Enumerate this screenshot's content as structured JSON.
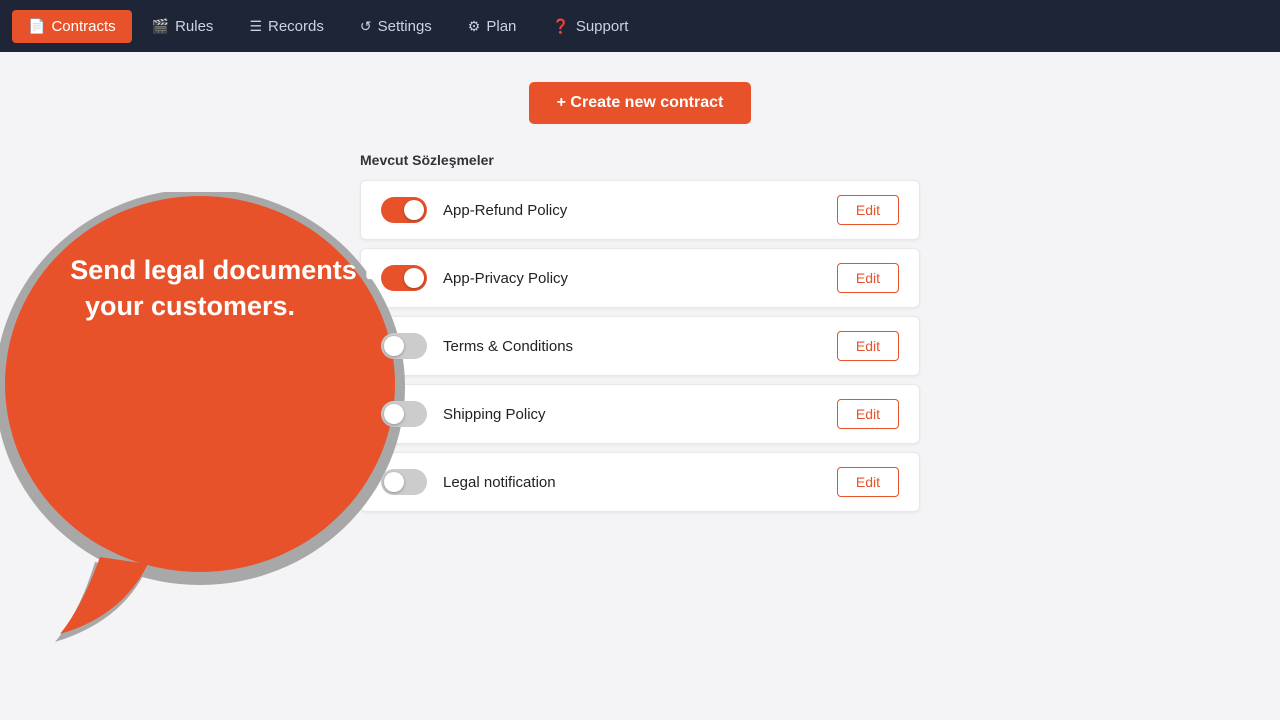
{
  "nav": {
    "items": [
      {
        "id": "contracts",
        "label": "Contracts",
        "icon": "📄",
        "active": true
      },
      {
        "id": "rules",
        "label": "Rules",
        "icon": "🎬",
        "active": false
      },
      {
        "id": "records",
        "label": "Records",
        "icon": "☰",
        "active": false
      },
      {
        "id": "settings",
        "label": "Settings",
        "icon": "↺",
        "active": false
      },
      {
        "id": "plan",
        "label": "Plan",
        "icon": "⚙",
        "active": false
      },
      {
        "id": "support",
        "label": "Support",
        "icon": "❓",
        "active": false
      }
    ]
  },
  "create_button": {
    "label": "+ Create new contract"
  },
  "section": {
    "title": "Mevcut Sözleşmeler",
    "contracts": [
      {
        "id": "refund",
        "name": "App-Refund Policy",
        "enabled": true
      },
      {
        "id": "privacy",
        "name": "App-Privacy Policy",
        "enabled": true
      },
      {
        "id": "terms",
        "name": "Terms & Conditions",
        "enabled": false
      },
      {
        "id": "shipping",
        "name": "Shipping Policy",
        "enabled": false
      },
      {
        "id": "legal",
        "name": "Legal notification",
        "enabled": false
      }
    ],
    "edit_label": "Edit"
  },
  "bubble": {
    "text": "Send legal documents to your customers."
  },
  "colors": {
    "accent": "#e8522a",
    "nav_bg": "#1e2537"
  }
}
